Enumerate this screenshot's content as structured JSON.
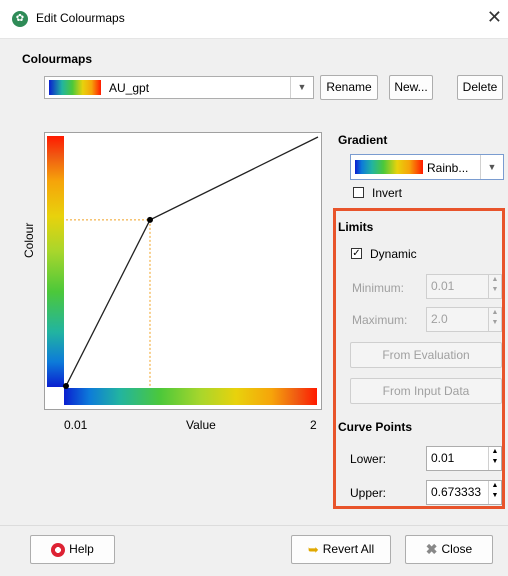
{
  "window": {
    "title": "Edit Colourmaps"
  },
  "colourmaps": {
    "heading": "Colourmaps",
    "selected": "AU_gpt",
    "rename_label": "Rename",
    "new_label": "New...",
    "delete_label": "Delete"
  },
  "chart_data": {
    "type": "line",
    "xlabel": "Value",
    "ylabel": "Colour",
    "x_ticks": [
      "0.01",
      "2"
    ],
    "xlim": [
      0.01,
      2
    ],
    "ylim": [
      0,
      1
    ],
    "series": [
      {
        "x": [
          0.01,
          0.673333,
          2
        ],
        "y": [
          0,
          0.667,
          1
        ]
      }
    ],
    "guides": {
      "x": 0.673333,
      "y": 0.667,
      "color": "#f0a020",
      "style": "dotted"
    }
  },
  "gradient": {
    "heading": "Gradient",
    "selected": "Rainb...",
    "invert_label": "Invert",
    "invert_checked": false
  },
  "limits": {
    "heading": "Limits",
    "dynamic_label": "Dynamic",
    "dynamic_checked": true,
    "minimum_label": "Minimum:",
    "minimum_value": "0.01",
    "maximum_label": "Maximum:",
    "maximum_value": "2.0",
    "from_evaluation_label": "From Evaluation",
    "from_input_data_label": "From Input Data"
  },
  "curve_points": {
    "heading": "Curve Points",
    "lower_label": "Lower:",
    "lower_value": "0.01",
    "upper_label": "Upper:",
    "upper_value": "0.673333"
  },
  "footer": {
    "help_label": "Help",
    "revert_all_label": "Revert All",
    "close_label": "Close"
  },
  "colors": {
    "highlight_frame": "#e8542b",
    "guide_line": "#f0a020"
  }
}
